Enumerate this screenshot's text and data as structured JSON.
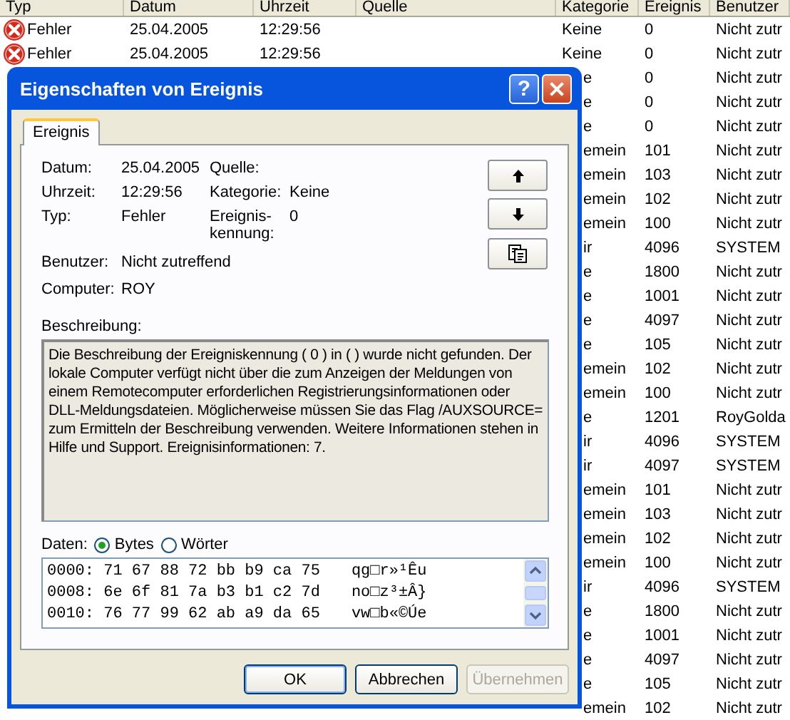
{
  "event_list": {
    "columns": [
      "Typ",
      "Datum",
      "Uhrzeit",
      "Quelle",
      "Kategorie",
      "Ereignis",
      "Benutzer"
    ],
    "rows": [
      {
        "kind": "full",
        "type": "Fehler",
        "date": "25.04.2005",
        "time": "12:29:56",
        "category": "Keine",
        "event": "0",
        "user": "Nicht zutr"
      },
      {
        "kind": "full",
        "type": "Fehler",
        "date": "25.04.2005",
        "time": "12:29:56",
        "category": "Keine",
        "event": "0",
        "user": "Nicht zutr"
      },
      {
        "kind": "covered",
        "category": "e",
        "event": "0",
        "user": "Nicht zutr"
      },
      {
        "kind": "covered",
        "category": "e",
        "event": "0",
        "user": "Nicht zutr"
      },
      {
        "kind": "covered",
        "category": "e",
        "event": "0",
        "user": "Nicht zutr"
      },
      {
        "kind": "covered",
        "category": "emein",
        "event": "101",
        "user": "Nicht zutr"
      },
      {
        "kind": "covered",
        "category": "emein",
        "event": "103",
        "user": "Nicht zutr"
      },
      {
        "kind": "covered",
        "category": "emein",
        "event": "102",
        "user": "Nicht zutr"
      },
      {
        "kind": "covered",
        "category": "emein",
        "event": "100",
        "user": "Nicht zutr"
      },
      {
        "kind": "covered",
        "category": "ir",
        "event": "4096",
        "user": "SYSTEM"
      },
      {
        "kind": "covered",
        "category": "e",
        "event": "1800",
        "user": "Nicht zutr"
      },
      {
        "kind": "covered",
        "category": "e",
        "event": "1001",
        "user": "Nicht zutr"
      },
      {
        "kind": "covered",
        "category": "e",
        "event": "4097",
        "user": "Nicht zutr"
      },
      {
        "kind": "covered",
        "category": "e",
        "event": "105",
        "user": "Nicht zutr"
      },
      {
        "kind": "covered",
        "category": "emein",
        "event": "102",
        "user": "Nicht zutr"
      },
      {
        "kind": "covered",
        "category": "emein",
        "event": "100",
        "user": "Nicht zutr"
      },
      {
        "kind": "covered",
        "category": "e",
        "event": "1201",
        "user": "RoyGolda"
      },
      {
        "kind": "covered",
        "category": "ir",
        "event": "4096",
        "user": "SYSTEM"
      },
      {
        "kind": "covered",
        "category": "ir",
        "event": "4097",
        "user": "SYSTEM"
      },
      {
        "kind": "covered",
        "category": "emein",
        "event": "101",
        "user": "Nicht zutr"
      },
      {
        "kind": "covered",
        "category": "emein",
        "event": "103",
        "user": "Nicht zutr"
      },
      {
        "kind": "covered",
        "category": "emein",
        "event": "102",
        "user": "Nicht zutr"
      },
      {
        "kind": "covered",
        "category": "emein",
        "event": "100",
        "user": "Nicht zutr"
      },
      {
        "kind": "covered",
        "category": "ir",
        "event": "4096",
        "user": "SYSTEM"
      },
      {
        "kind": "covered",
        "category": "e",
        "event": "1800",
        "user": "Nicht zutr"
      },
      {
        "kind": "covered",
        "category": "e",
        "event": "1001",
        "user": "Nicht zutr"
      },
      {
        "kind": "covered",
        "category": "e",
        "event": "4097",
        "user": "Nicht zutr"
      },
      {
        "kind": "covered",
        "category": "e",
        "event": "105",
        "user": "Nicht zutr"
      },
      {
        "kind": "covered",
        "category": "emein",
        "event": "102",
        "user": "Nicht zutr"
      }
    ]
  },
  "dialog": {
    "title": "Eigenschaften von Ereignis",
    "help_button": "?",
    "tabs": [
      {
        "label": "Ereignis",
        "selected": true
      }
    ],
    "fields_left": [
      {
        "label": "Datum:",
        "value": "25.04.2005"
      },
      {
        "label": "Uhrzeit:",
        "value": "12:29:56"
      },
      {
        "label": "Typ:",
        "value": "Fehler"
      }
    ],
    "fields_right": [
      {
        "label": "Quelle:"
      },
      {
        "label": "Kategorie:",
        "value": "Keine"
      },
      {
        "label": "Ereignis-\nkennung:",
        "value": "0"
      }
    ],
    "fields_bottom": [
      {
        "label": "Benutzer:",
        "value": "Nicht zutreffend"
      },
      {
        "label": "Computer:",
        "value": "ROY"
      }
    ],
    "description_label": "Beschreibung:",
    "description": "Die Beschreibung der Ereigniskennung ( 0 ) in (  ) wurde nicht gefunden. Der lokale Computer verfügt nicht über die zum Anzeigen der Meldungen von einem Remotecomputer erforderlichen Registrierungsinformationen oder DLL-Meldungsdateien. Möglicherweise müssen Sie das Flag /AUXSOURCE= zum Ermitteln der Beschreibung verwenden. Weitere Informationen stehen in Hilfe und Support. Ereignisinformationen: 7.",
    "data_label": "Daten:",
    "data_modes": [
      {
        "label": "Bytes",
        "selected": true
      },
      {
        "label": "Wörter",
        "selected": false
      }
    ],
    "data_lines": [
      {
        "hex": "0000: 71 67 88 72 bb b9 ca 75",
        "ascii": "qg□r»¹Êu"
      },
      {
        "hex": "0008: 6e 6f 81 7a b3 b1 c2 7d",
        "ascii": "no□z³±Â}"
      },
      {
        "hex": "0010: 76 77 99 62 ab a9 da 65",
        "ascii": "vw□b«©Úe"
      }
    ],
    "buttons": [
      {
        "label": "OK",
        "disabled": false,
        "default": true
      },
      {
        "label": "Abbrechen",
        "disabled": false,
        "default": false
      },
      {
        "label": "Übernehmen",
        "disabled": true,
        "default": false
      }
    ]
  }
}
